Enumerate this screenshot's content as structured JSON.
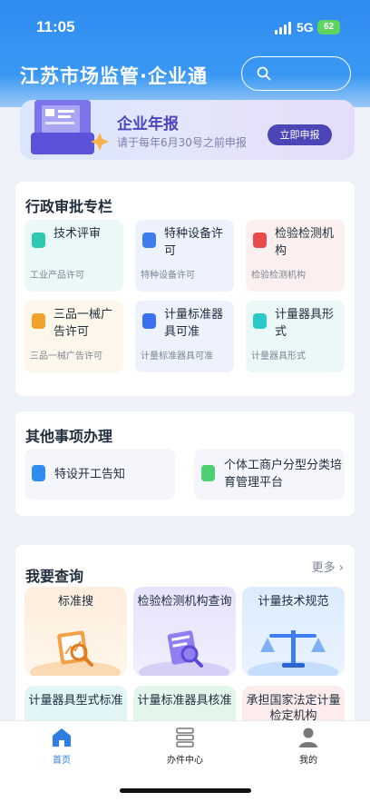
{
  "status_bar": {
    "time": "11:05",
    "network": "5G",
    "battery": "62"
  },
  "header": {
    "title": "江苏市场监管·企业通",
    "search_icon": "search-icon"
  },
  "banner": {
    "title": "企业年报",
    "subtitle": "请于每年6月30号之前申报",
    "button": "立即申报"
  },
  "admin_section": {
    "title": "行政审批专栏",
    "items": [
      {
        "name": "技术评审",
        "desc": "工业产品许可",
        "color": "#2fc9b0"
      },
      {
        "name": "特种设备许可",
        "desc": "特种设备许可",
        "color": "#3d7df0"
      },
      {
        "name": "检验检测机构",
        "desc": "检验检测机构",
        "color": "#e84b4b"
      },
      {
        "name": "三品一械广告许可",
        "desc": "三品一械广告许可",
        "color": "#f3a12c"
      },
      {
        "name": "计量标准器具可准",
        "desc": "计量标准器具可准",
        "color": "#3a6ff0"
      },
      {
        "name": "计量器具形式",
        "desc": "计量器具形式",
        "color": "#2cc7c9"
      }
    ]
  },
  "other_section": {
    "title": "其他事项办理",
    "items": [
      {
        "name": "特设开工告知",
        "color": "#2f8cf0"
      },
      {
        "name": "个体工商户分型分类培育管理平台",
        "color": "#4cd070"
      }
    ]
  },
  "query_section": {
    "title": "我要查询",
    "more": "更多",
    "items": [
      {
        "name": "标准搜"
      },
      {
        "name": "检验检测机构查询"
      },
      {
        "name": "计量技术规范"
      },
      {
        "name": "计量器具型式标准"
      },
      {
        "name": "计量标准器具核准"
      },
      {
        "name": "承担国家法定计量检定机构"
      }
    ]
  },
  "tabs": [
    {
      "label": "首页",
      "icon": "home-icon",
      "active": true
    },
    {
      "label": "办件中心",
      "icon": "server-icon",
      "active": false
    },
    {
      "label": "我的",
      "icon": "user-icon",
      "active": false
    }
  ]
}
